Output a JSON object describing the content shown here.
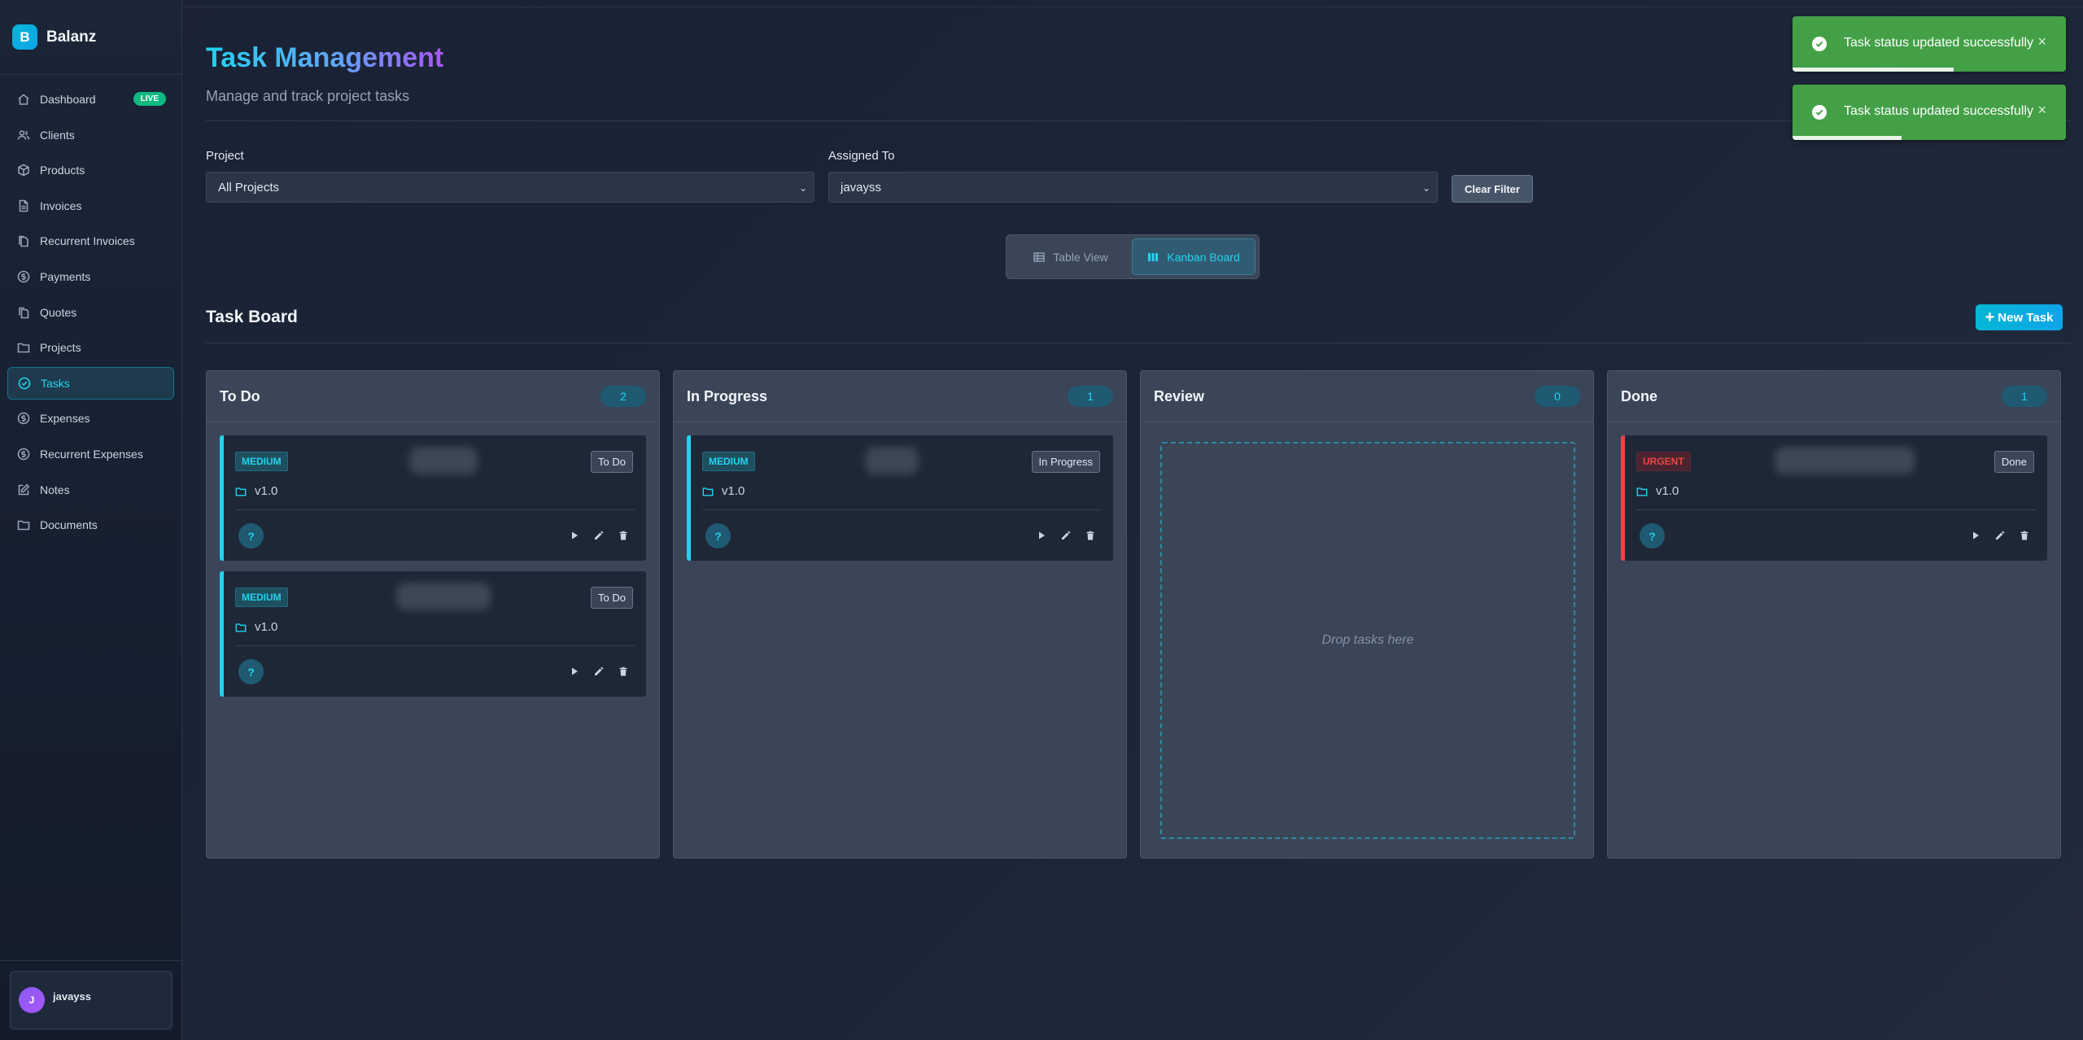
{
  "brand": {
    "logo_letter": "B",
    "name": "Balanz"
  },
  "sidebar": {
    "items": [
      {
        "label": "Dashboard",
        "icon": "home-icon",
        "badge": "LIVE",
        "active": false
      },
      {
        "label": "Clients",
        "icon": "users-icon",
        "active": false
      },
      {
        "label": "Products",
        "icon": "box-icon",
        "active": false
      },
      {
        "label": "Invoices",
        "icon": "file-icon",
        "active": false
      },
      {
        "label": "Recurrent Invoices",
        "icon": "files-icon",
        "active": false
      },
      {
        "label": "Payments",
        "icon": "dollar-circle-icon",
        "active": false
      },
      {
        "label": "Quotes",
        "icon": "copy-icon",
        "active": false
      },
      {
        "label": "Projects",
        "icon": "folder-icon",
        "active": false
      },
      {
        "label": "Tasks",
        "icon": "check-circle-icon",
        "active": true
      },
      {
        "label": "Expenses",
        "icon": "dollar-circle-icon",
        "active": false
      },
      {
        "label": "Recurrent Expenses",
        "icon": "dollar-circle-icon",
        "active": false
      },
      {
        "label": "Notes",
        "icon": "pencil-square-icon",
        "active": false
      },
      {
        "label": "Documents",
        "icon": "folder-icon",
        "active": false
      }
    ],
    "user": {
      "initial": "J",
      "name": "javayss"
    }
  },
  "header": {
    "title": "Task Management",
    "subtitle": "Manage and track project tasks"
  },
  "filters": {
    "project_label": "Project",
    "project_value": "All Projects",
    "assigned_label": "Assigned To",
    "assigned_value": "javayss",
    "clear_label": "Clear Filter"
  },
  "view_toggle": {
    "table_label": "Table View",
    "kanban_label": "Kanban Board",
    "selected": "Kanban Board"
  },
  "board": {
    "title": "Task Board",
    "new_task_label": "New Task",
    "columns": [
      {
        "title": "To Do",
        "count": "2",
        "tasks": [
          {
            "priority": "MEDIUM",
            "status": "To Do",
            "project": "v1.0",
            "assignee": "?"
          },
          {
            "priority": "MEDIUM",
            "status": "To Do",
            "project": "v1.0",
            "assignee": "?"
          }
        ]
      },
      {
        "title": "In Progress",
        "count": "1",
        "tasks": [
          {
            "priority": "MEDIUM",
            "status": "In Progress",
            "project": "v1.0",
            "assignee": "?"
          }
        ]
      },
      {
        "title": "Review",
        "count": "0",
        "empty_text": "Drop tasks here",
        "tasks": []
      },
      {
        "title": "Done",
        "count": "1",
        "tasks": [
          {
            "priority": "URGENT",
            "status": "Done",
            "project": "v1.0",
            "assignee": "?"
          }
        ]
      }
    ]
  },
  "toasts": [
    {
      "message": "Task status updated successfully",
      "close": "×",
      "progress": 0.59
    },
    {
      "message": "Task status updated successfully",
      "close": "×",
      "progress": 0.4
    }
  ],
  "colors": {
    "accent": "#22d3ee",
    "success": "#43a047",
    "urgent": "#ef4444",
    "live": "#10b981"
  }
}
